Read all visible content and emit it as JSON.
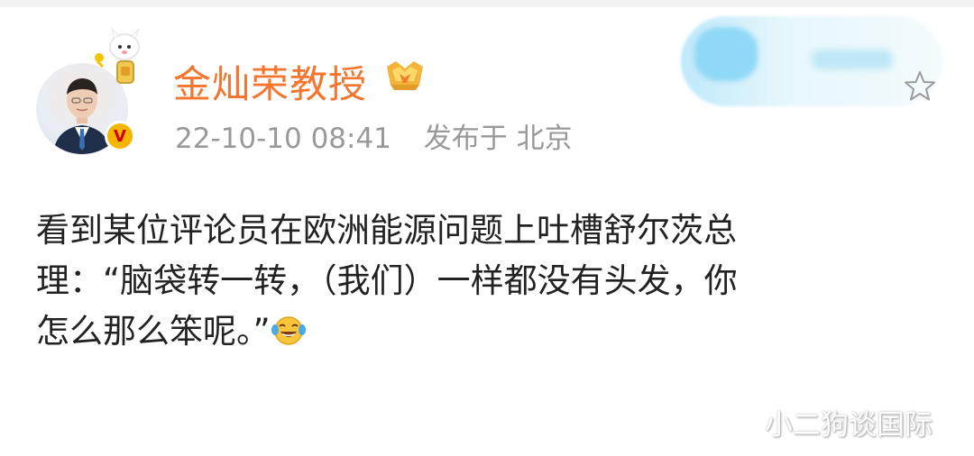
{
  "post": {
    "author": {
      "name": "金灿荣教授",
      "avatar_icon": "avatar-portrait",
      "verified_icon": "verified-v-icon",
      "verified_letter": "V",
      "level_icon": "vip-crown-badge-icon"
    },
    "timestamp": "22-10-10 08:41",
    "location": "发布于 北京",
    "content": {
      "line1": "看到某位评论员在欧洲能源问题上吐槽舒尔茨总",
      "line2": "理：“脑袋转一转，（我们）一样都没有头发，你",
      "line3": "怎么那么笨呢。”",
      "emoji_icon": "laugh-cry-emoji-icon"
    }
  },
  "watermark": {
    "text": "小二狗谈国际"
  },
  "colors": {
    "author_name": "#f5742e",
    "meta_text": "#999999",
    "body_text": "#222222",
    "verified_badge": "#f5b400"
  }
}
